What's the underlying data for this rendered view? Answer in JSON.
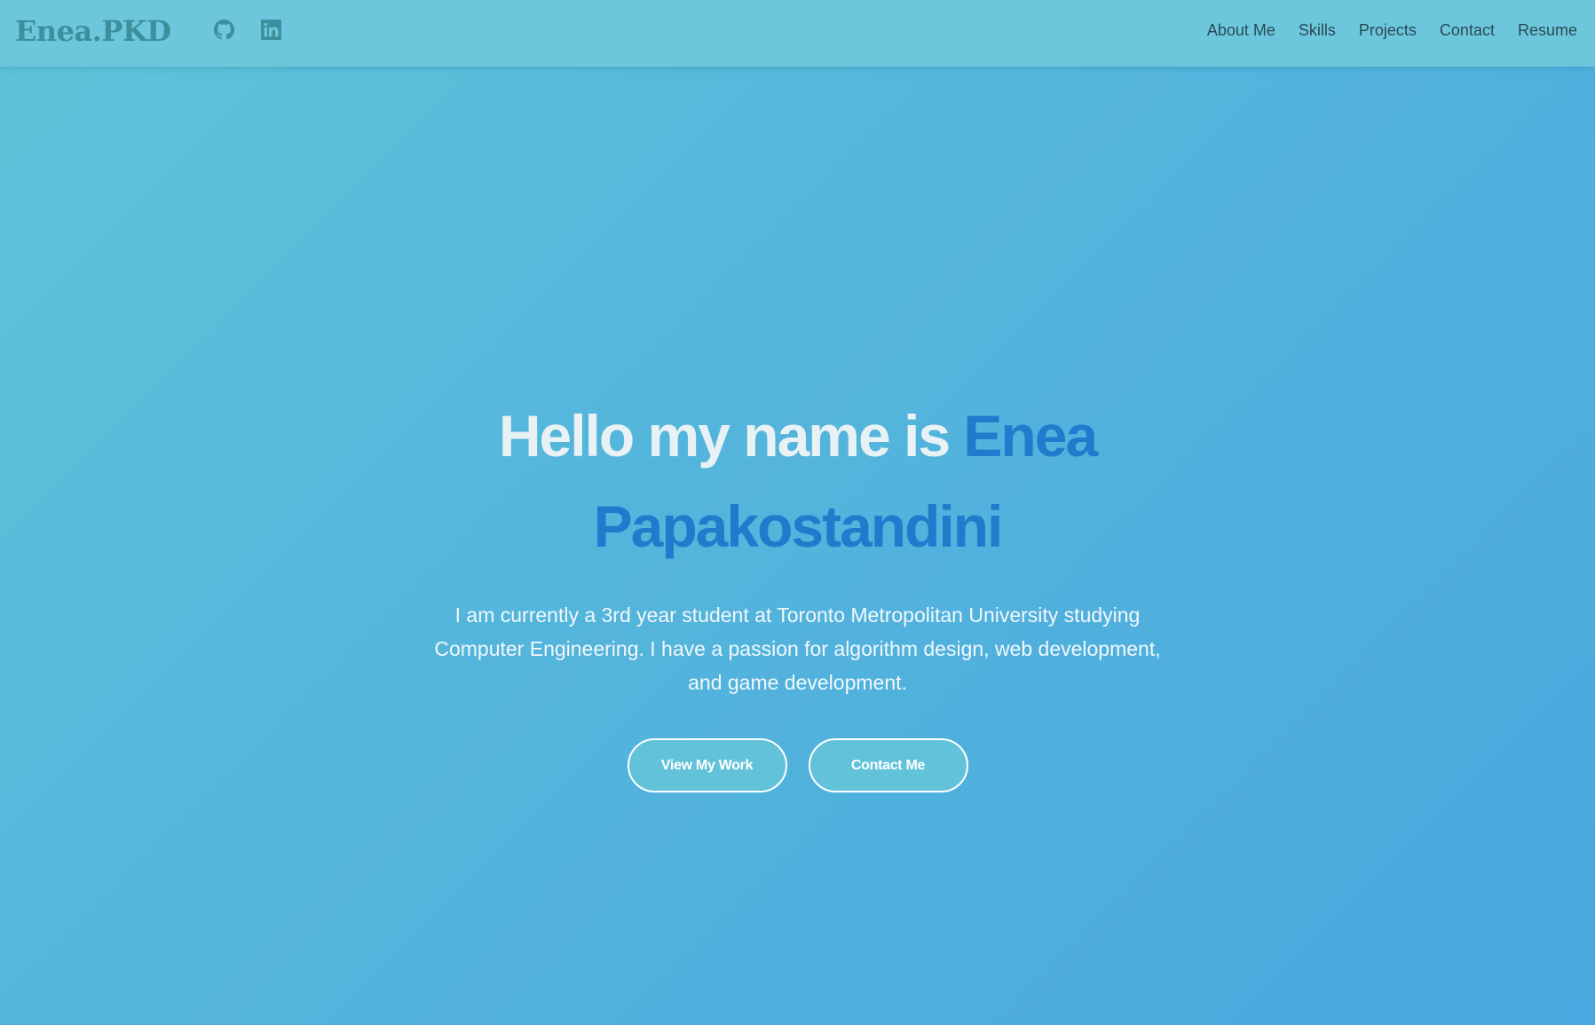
{
  "navbar": {
    "brand": "Enea.PKD",
    "social": [
      {
        "icon": "github-icon"
      },
      {
        "icon": "linkedin-icon"
      }
    ],
    "links": [
      "About Me",
      "Skills",
      "Projects",
      "Contact",
      "Resume"
    ]
  },
  "hero": {
    "greeting": "Hello my name is ",
    "name": "Enea Papakostandini",
    "description": "I am currently a 3rd year student at Toronto Metropolitan University studying Computer Engineering. I have a passion for algorithm design, web development, and game development.",
    "buttons": {
      "view_work": "View My Work",
      "contact": "Contact Me"
    }
  },
  "colors": {
    "name_accent": "#1f7ccd",
    "brand": "#3c8f9c",
    "navbar_bg": "#6cc7dc",
    "button_bg": "#62c2da"
  }
}
